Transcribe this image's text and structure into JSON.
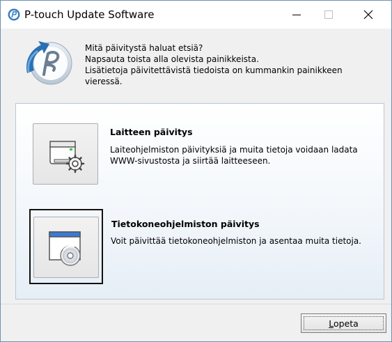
{
  "window": {
    "title": "P-touch Update Software",
    "controls": {
      "minimize_icon": "minimize-icon",
      "maximize_icon": "maximize-icon",
      "close_icon": "close-icon"
    }
  },
  "intro": {
    "lines": [
      "Mitä päivitystä haluat etsiä?",
      "Napsauta toista alla olevista painikkeista.",
      "Lisätietoja päivitettävistä tiedoista on kummankin painikkeen",
      "vieressä."
    ]
  },
  "options": [
    {
      "title": "Laitteen päivitys",
      "desc_lines": [
        "Laiteohjelmiston päivityksiä ja muita tietoja voidaan ladata",
        "WWW-sivustosta ja siirtää laitteeseen."
      ],
      "icon": "printer-gear-icon"
    },
    {
      "title": "Tietokoneohjelmiston päivitys",
      "desc_lines": [
        "Voit päivittää tietokoneohjelmiston ja asentaa muita tietoja."
      ],
      "icon": "window-disc-icon"
    }
  ],
  "footer": {
    "quit_label_first": "L",
    "quit_label_rest": "opeta"
  },
  "colors": {
    "logo_blue": "#2b6fb3",
    "panel_border": "#b7c7d6"
  }
}
